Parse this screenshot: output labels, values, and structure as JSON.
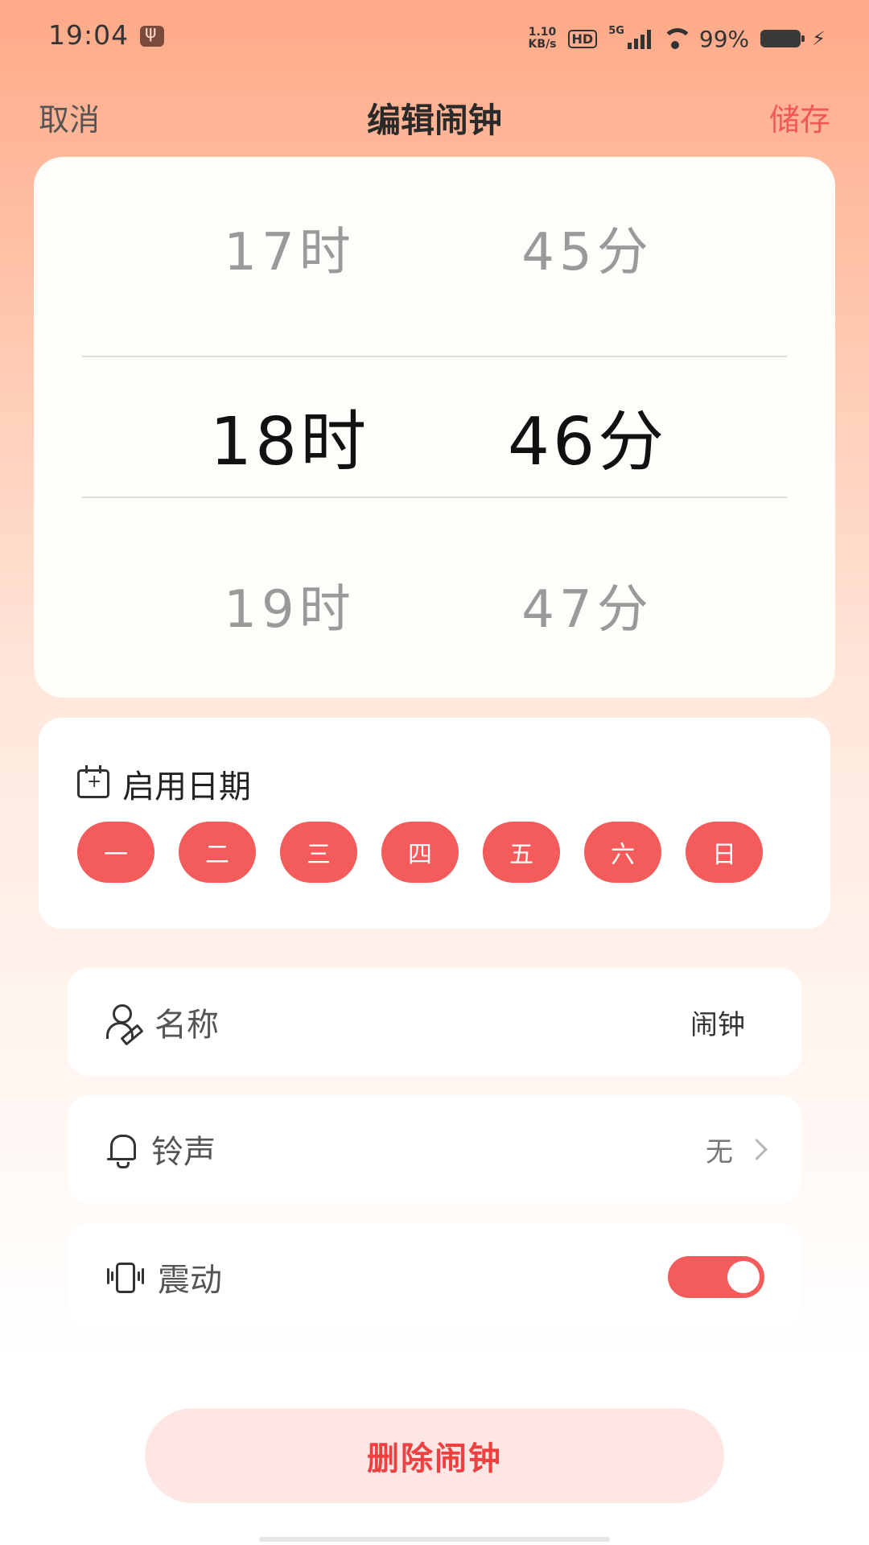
{
  "status_bar": {
    "time": "19:04",
    "net_speed_value": "1.10",
    "net_speed_unit": "KB/s",
    "hd": "HD",
    "network": "5G",
    "battery": "99%"
  },
  "header": {
    "cancel_label": "取消",
    "title": "编辑闹钟",
    "save_label": "储存"
  },
  "picker": {
    "hours": {
      "prev": "17时",
      "selected": "18时",
      "next": "19时"
    },
    "minutes": {
      "prev": "45分",
      "selected": "46分",
      "next": "47分"
    }
  },
  "repeat_days": {
    "title": "启用日期",
    "days": [
      "一",
      "二",
      "三",
      "四",
      "五",
      "六",
      "日"
    ]
  },
  "settings": {
    "name": {
      "label": "名称",
      "value": "闹钟"
    },
    "ringtone": {
      "label": "铃声",
      "value": "无"
    },
    "vibrate": {
      "label": "震动",
      "enabled": true
    }
  },
  "delete_label": "删除闹钟",
  "colors": {
    "accent": "#f45b5b",
    "save_text": "#f25757",
    "delete_bg": "#fde6e4"
  },
  "icons": {
    "day_title": "calendar-plus-icon",
    "name": "user-edit-icon",
    "ringtone": "bell-icon",
    "vibrate": "vibrate-icon"
  }
}
